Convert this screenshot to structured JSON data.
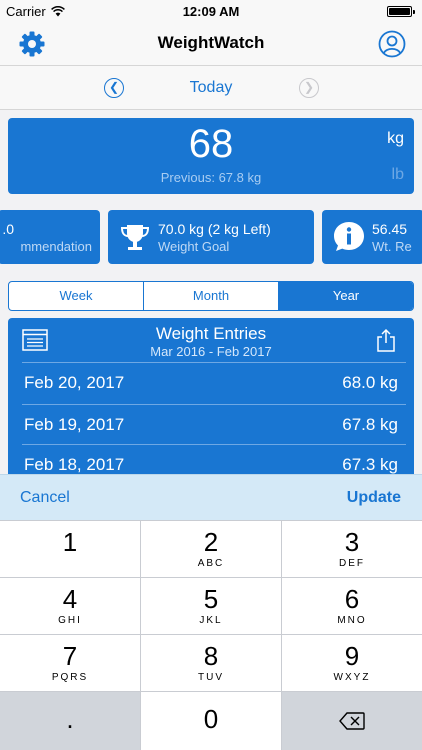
{
  "status_bar": {
    "carrier": "Carrier",
    "time": "12:09 AM"
  },
  "nav": {
    "title": "WeightWatch"
  },
  "date_nav": {
    "label": "Today"
  },
  "current": {
    "value": "68",
    "previous": "Previous: 67.8 kg",
    "unit_kg": "kg",
    "unit_lb": "lb"
  },
  "stats": [
    {
      "title": ".0",
      "subtitle": "mmendation"
    },
    {
      "title": "70.0 kg (2 kg Left)",
      "subtitle": "Weight Goal"
    },
    {
      "title": "56.45",
      "subtitle": "Wt. Re"
    }
  ],
  "tabs": [
    "Week",
    "Month",
    "Year"
  ],
  "active_tab": "Year",
  "entries": {
    "title": "Weight Entries",
    "range": "Mar 2016 - Feb 2017",
    "rows": [
      {
        "date": "Feb 20, 2017",
        "value": "68.0 kg"
      },
      {
        "date": "Feb 19, 2017",
        "value": "67.8 kg"
      },
      {
        "date": "Feb 18, 2017",
        "value": "67.3 kg"
      }
    ]
  },
  "accessory": {
    "cancel": "Cancel",
    "update": "Update"
  },
  "keypad": [
    {
      "num": "1",
      "letters": ""
    },
    {
      "num": "2",
      "letters": "ABC"
    },
    {
      "num": "3",
      "letters": "DEF"
    },
    {
      "num": "4",
      "letters": "GHI"
    },
    {
      "num": "5",
      "letters": "JKL"
    },
    {
      "num": "6",
      "letters": "MNO"
    },
    {
      "num": "7",
      "letters": "PQRS"
    },
    {
      "num": "8",
      "letters": "TUV"
    },
    {
      "num": "9",
      "letters": "WXYZ"
    },
    {
      "num": ".",
      "letters": ""
    },
    {
      "num": "0",
      "letters": ""
    }
  ],
  "colors": {
    "accent": "#1976d2",
    "accessory_bar": "#d4e9f7",
    "keypad_bg": "#c9ccd2"
  }
}
